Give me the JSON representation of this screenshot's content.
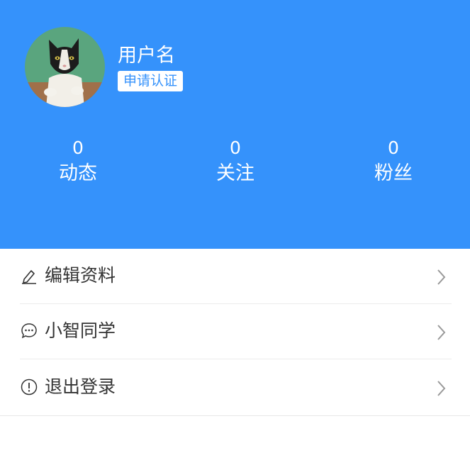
{
  "profile": {
    "avatar_icon": "cat-avatar-icon",
    "username": "用户名",
    "verify_label": "申请认证"
  },
  "stats": [
    {
      "count": "0",
      "label": "动态"
    },
    {
      "count": "0",
      "label": "关注"
    },
    {
      "count": "0",
      "label": "粉丝"
    }
  ],
  "menu": {
    "items": [
      {
        "icon": "edit-pencil-icon",
        "label": "编辑资料"
      },
      {
        "icon": "chat-bubble-icon",
        "label": "小智同学"
      },
      {
        "icon": "exclamation-circle-icon",
        "label": "退出登录"
      }
    ]
  },
  "colors": {
    "header_bg": "#3592fb",
    "text_white": "#ffffff",
    "menu_text": "#333333",
    "chevron": "#999999"
  }
}
